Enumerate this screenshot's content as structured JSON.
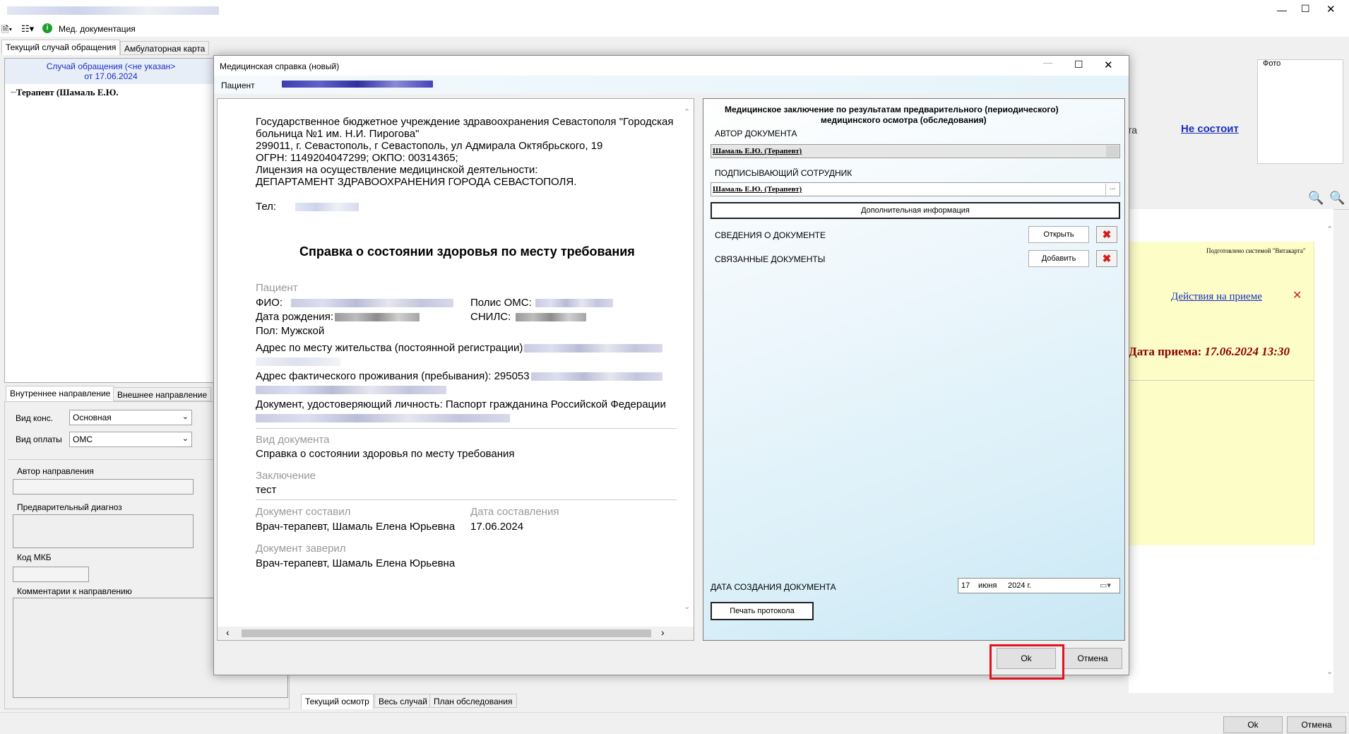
{
  "window": {
    "toolbar_label": "Мед. документация"
  },
  "main_tabs": [
    "Текущий случай обращения",
    "Амбулаторная карта"
  ],
  "case": {
    "header_line1": "Случай обращения (<не указан>",
    "header_line2": "от 17.06.2024",
    "tree_item": "Терапевт (Шамаль Е.Ю."
  },
  "direction": {
    "tabs": [
      "Внутреннее направление",
      "Внешнее направление"
    ],
    "vid_kons_label": "Вид конс.",
    "vid_kons_value": "Основная",
    "vid_oplaty_label": "Вид оплаты",
    "vid_oplaty_value": "ОМС",
    "author_label": "Автор направления",
    "diag_label": "Предварительный диагноз",
    "mkb_label": "Код МКБ",
    "comment_label": "Комментарии к направлению"
  },
  "right_bg": {
    "photo_label": "Фото",
    "ta_fragment": "та",
    "status_link": "Не состоит",
    "prepared_by": "Подготовлено системой \"Витакарта\"",
    "actions_link": "Действия на приеме",
    "date_label": "Дата приема:",
    "date_value": "17.06.2024 13:30",
    "bottom_tabs": [
      "Текущий осмотр",
      "Весь случай",
      "План обследования"
    ]
  },
  "main_buttons": {
    "ok": "Ok",
    "cancel": "Отмена"
  },
  "dialog": {
    "title": "Медицинская справка (новый)",
    "patient_label": "Пациент",
    "doc": {
      "org_line1": "Государственное бюджетное учреждение здравоохранения Севастополя \"Городская",
      "org_line2": "больница №1 им. Н.И. Пирогова\"",
      "org_line3": "299011, г. Севастополь, г Севастополь, ул Адмирала Октябрьского, 19",
      "org_line4": "ОГРН: 1149204047299; ОКПО: 00314365;",
      "org_line5": "Лицензия на осуществление медицинской деятельности:",
      "org_line6": "ДЕПАРТАМЕНТ ЗДРАВООХРАНЕНИЯ ГОРОДА СЕВАСТОПОЛЯ.",
      "tel_label": "Тел:",
      "title": "Справка о состоянии здоровья по месту требования",
      "patient_section": "Пациент",
      "fio_label": "ФИО:",
      "polis_label": "Полис ОМС:",
      "birth_label": "Дата рождения:",
      "snils_label": "СНИЛС:",
      "sex": "Пол: Мужской",
      "address_reg_label": "Адрес по месту жительства (постоянной регистрации):",
      "address_fact_label": "Адрес фактического проживания (пребывания): 295053",
      "id_doc": "Документ, удостоверяющий личность: Паспорт гражданина Российской Федерации",
      "doc_type_label": "Вид документа",
      "doc_type_value": "Справка о состоянии здоровья по месту требования",
      "conclusion_label": "Заключение",
      "conclusion_value": "тест",
      "composed_label": "Документ составил",
      "composed_value": "Врач-терапевт, Шамаль Елена Юрьевна",
      "date_label": "Дата составления",
      "date_value": "17.06.2024",
      "certified_label": "Документ заверил",
      "certified_value": "Врач-терапевт, Шамаль Елена Юрьевна"
    },
    "panel": {
      "title_line1": "Медицинское заключение по результатам предварительного (периодического)",
      "title_line2": "медицинского осмотра (обследования)",
      "author_label": "АВТОР ДОКУМЕНТА",
      "author_value": "Шамаль Е.Ю. (Терапевт)",
      "signer_label": "ПОДПИСЫВАЮЩИЙ СОТРУДНИК",
      "signer_value": "Шамаль Е.Ю. (Терапевт)",
      "extra_info_button": "Дополнительная информация",
      "doc_info_label": "СВЕДЕНИЯ О ДОКУМЕНТЕ",
      "open_button": "Открыть",
      "linked_docs_label": "СВЯЗАННЫЕ ДОКУМЕНТЫ",
      "add_button": "Добавить",
      "creation_date_label": "ДАТА СОЗДАНИЯ ДОКУМЕНТА",
      "date_day": "17",
      "date_month": "июня",
      "date_year": "2024 г.",
      "print_button": "Печать протокола"
    },
    "ok_button": "Ok",
    "cancel_button": "Отмена"
  }
}
